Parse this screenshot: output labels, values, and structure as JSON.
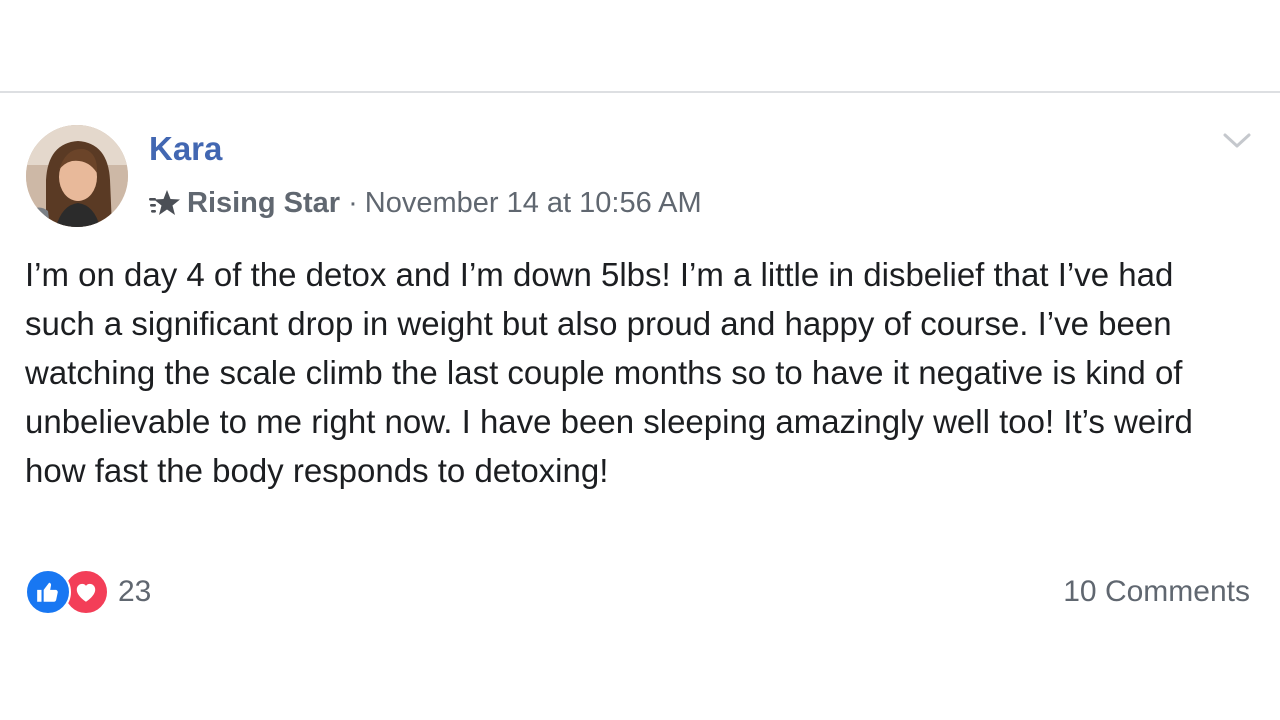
{
  "post": {
    "author": "Kara",
    "badge": "Rising Star",
    "separator": "·",
    "timestamp": "November 14 at 10:56 AM",
    "text": "I’m on day 4 of the detox and I’m down 5lbs! I’m a little in disbelief that I’ve had such a significant drop in weight but also proud and happy of course. I’ve been watching the scale climb the last couple months so to have it negative is kind of unbelievable to me right now. I have been sleeping amazingly well too! It’s weird how fast the body responds to detoxing!",
    "reactions": {
      "icons": [
        "like-icon",
        "love-icon"
      ],
      "count": "23"
    },
    "comments_label": "10 Comments"
  },
  "colors": {
    "author": "#4267b2",
    "meta": "#606770",
    "body": "#1c1e21",
    "like": "#1877f2",
    "love": "#f33e58",
    "divider": "#dddfe2"
  }
}
